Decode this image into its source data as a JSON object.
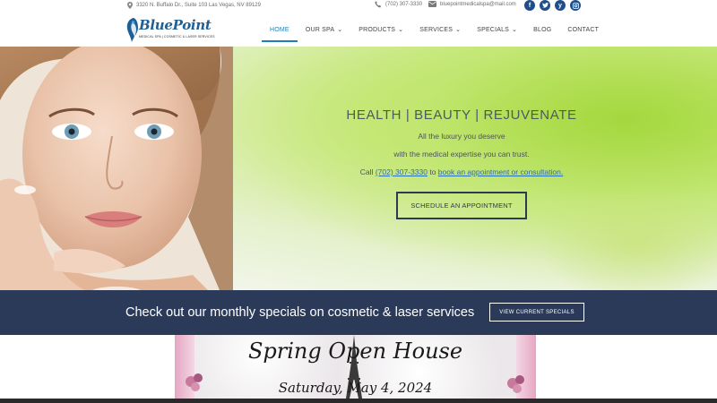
{
  "topbar": {
    "address": "3320 N. Buffalo Dr., Suite 103 Las Vegas, NV 89129",
    "phone": "(702) 307-3330",
    "email": "bluepointmedicalspa@mail.com",
    "socials": [
      "facebook-icon",
      "twitter-icon",
      "yelp-icon",
      "instagram-icon"
    ]
  },
  "brand": {
    "name": "BluePoint",
    "tagline": "MEDICAL SPA | COSMETIC & LASER SERVICES",
    "color": "#1e5f95"
  },
  "nav": {
    "items": [
      {
        "label": "HOME",
        "active": true,
        "dropdown": false
      },
      {
        "label": "OUR SPA",
        "active": false,
        "dropdown": true
      },
      {
        "label": "PRODUCTS",
        "active": false,
        "dropdown": true
      },
      {
        "label": "SERVICES",
        "active": false,
        "dropdown": true
      },
      {
        "label": "SPECIALS",
        "active": false,
        "dropdown": true
      },
      {
        "label": "BLOG",
        "active": false,
        "dropdown": false
      },
      {
        "label": "CONTACT",
        "active": false,
        "dropdown": false
      }
    ],
    "accent": "#1e7fb8"
  },
  "hero": {
    "title": "HEALTH | BEAUTY | REJUVENATE",
    "line1": "All the luxury you deserve",
    "line2": "with the medical expertise you can trust.",
    "call_prefix": "Call",
    "call_phone": "(702) 307-3330",
    "call_mid": "to",
    "call_link": "book an appointment or consultation.",
    "cta": "SCHEDULE AN APPOINTMENT"
  },
  "band": {
    "text": "Check out our monthly specials on cosmetic & laser services",
    "button": "VIEW CURRENT SPECIALS",
    "color": "#2c3a5a"
  },
  "banner": {
    "title": "Spring Open House",
    "date": "Saturday, May 4, 2024"
  }
}
